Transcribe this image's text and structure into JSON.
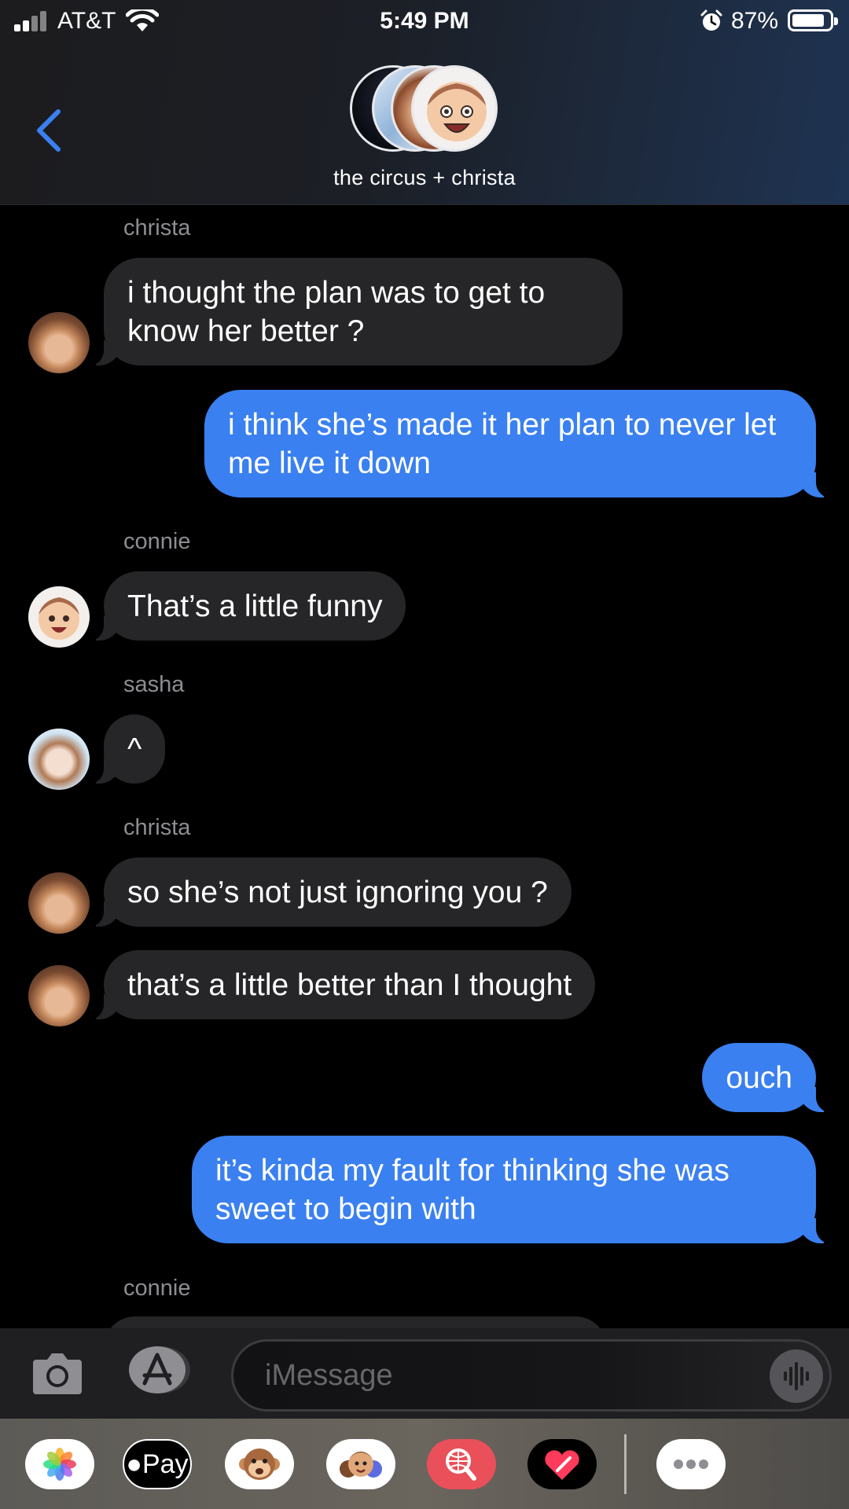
{
  "status_bar": {
    "carrier": "AT&T",
    "time": "5:49 PM",
    "battery_percent": "87%",
    "battery_level": 0.87,
    "icons": [
      "signal-icon",
      "wifi-icon",
      "alarm-icon",
      "battery-icon"
    ]
  },
  "header": {
    "group_name": "the circus + christa",
    "back_icon": "chevron-left-icon"
  },
  "messages": [
    {
      "type": "sender",
      "text": "christa"
    },
    {
      "type": "incoming",
      "text": "i thought the plan was to get to know her better ?",
      "avatar": "christa"
    },
    {
      "type": "outgoing",
      "text": "i think she’s made it her plan to never let me live it down"
    },
    {
      "type": "sender",
      "text": "connie"
    },
    {
      "type": "incoming",
      "text": "That’s a little funny",
      "avatar": "connie"
    },
    {
      "type": "sender",
      "text": "sasha"
    },
    {
      "type": "incoming",
      "text": "^",
      "avatar": "sasha"
    },
    {
      "type": "sender",
      "text": "christa"
    },
    {
      "type": "incoming",
      "text": "so she’s not just ignoring you ?",
      "avatar": "christa"
    },
    {
      "type": "incoming",
      "text": "that’s a little better than I thought",
      "avatar": "christa"
    },
    {
      "type": "outgoing",
      "text": "ouch"
    },
    {
      "type": "outgoing",
      "text": "it’s kinda my fault for thinking she was sweet to begin with"
    },
    {
      "type": "sender",
      "text": "connie"
    }
  ],
  "composer": {
    "placeholder": "iMessage",
    "camera_icon": "camera-icon",
    "apps_icon": "app-store-icon",
    "voice_icon": "voice-waveform-icon"
  },
  "app_drawer": {
    "apple_pay_label": "Pay",
    "apps": [
      "photos-icon",
      "apple-pay-icon",
      "animoji-icon",
      "memoji-icon",
      "image-search-icon",
      "digital-touch-icon",
      "more-apps-icon"
    ]
  },
  "colors": {
    "outgoing_bubble": "#3a80f0",
    "incoming_bubble": "#262628",
    "accent": "#3a80f0",
    "sender_label": "#8d8d93"
  }
}
